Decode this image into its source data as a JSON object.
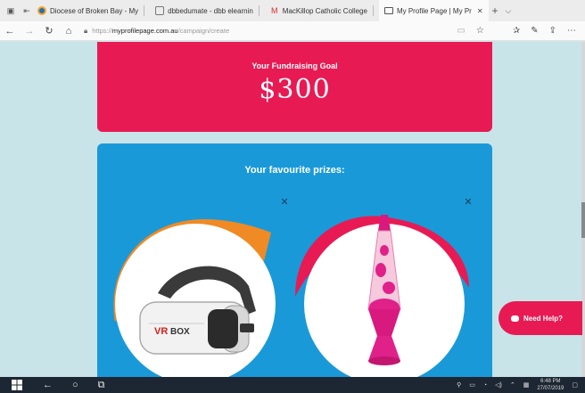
{
  "browser": {
    "tabs": [
      {
        "label": "Diocese of Broken Bay - My",
        "color": "#1e6fc4"
      },
      {
        "label": "dbbedumate - dbb elearnin",
        "color": "#777777"
      },
      {
        "label": "MacKillop Catholic College",
        "color": "#d93025"
      },
      {
        "label": "My Profile Page | My Pr",
        "color": "#555555",
        "active": true
      }
    ],
    "tab_close": "✕",
    "new_tab": "+",
    "url_host": "https://myprofilepage.com.au",
    "url_path": "/campaign/create",
    "url_host_bold": "myprofilepage.com.au"
  },
  "page": {
    "goal_label": "Your Fundraising Goal",
    "goal_amount": "$300",
    "prizes_title": "Your favourite prizes:",
    "remove_symbol": "✕",
    "prizes": [
      {
        "name": "VR BOX headset",
        "icon": "vr-headset-image",
        "blob_color": "#f08a24"
      },
      {
        "name": "Pink lava lamp",
        "icon": "lava-lamp-image",
        "blob_color": "#e81a54"
      }
    ],
    "help_label": "Need Help?"
  },
  "taskbar": {
    "time": "6:48 PM",
    "date": "27/07/2019"
  },
  "colors": {
    "brand_pink": "#e81a54",
    "prize_blue": "#1a99d8",
    "page_bg": "#c8e4e9"
  }
}
